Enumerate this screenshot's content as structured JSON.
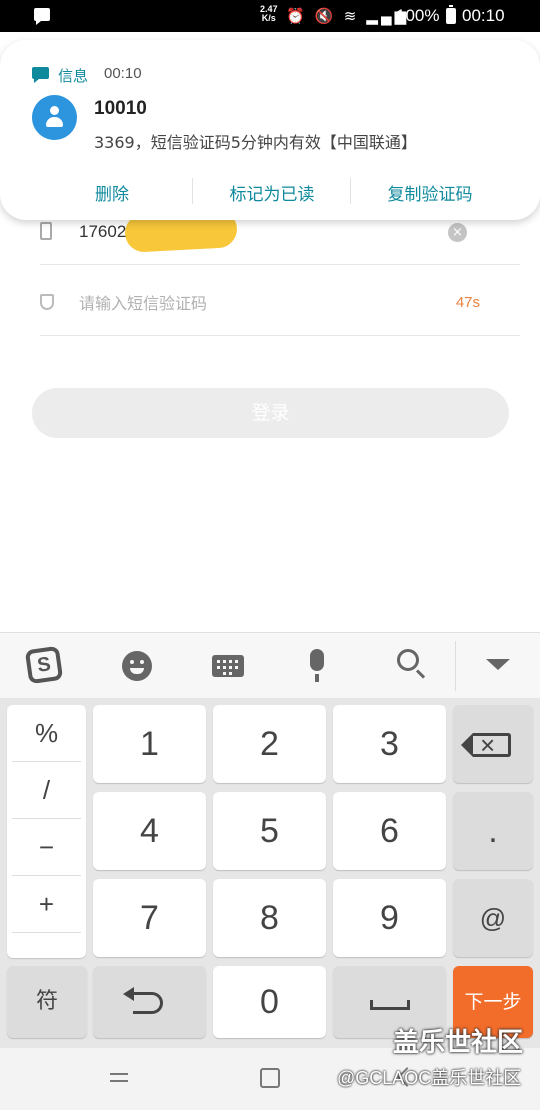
{
  "status_bar": {
    "net_speed": "2.47\nK/s",
    "battery": "100%",
    "time": "00:10"
  },
  "notification": {
    "app_name": "信息",
    "time": "00:10",
    "sender": "10010",
    "body": "3369，短信验证码5分钟内有效【中国联通】",
    "actions": {
      "delete": "删除",
      "mark_read": "标记为已读",
      "copy_code": "复制验证码"
    }
  },
  "login": {
    "phone_value": "17602",
    "code_placeholder": "请输入短信验证码",
    "countdown": "47s",
    "login_label": "登录"
  },
  "keyboard": {
    "symbols": [
      "%",
      "/",
      "−",
      "+"
    ],
    "digits": [
      "1",
      "2",
      "3",
      "4",
      "5",
      "6",
      "7",
      "8",
      "9",
      "0"
    ],
    "dot": ".",
    "at": "@",
    "fu": "符",
    "next": "下一步",
    "sogou_letter": "S",
    "accent_color": "#f26c2a"
  },
  "watermark": {
    "line1": "盖乐世社区",
    "line2": "@GCLAOC盖乐世社区"
  }
}
